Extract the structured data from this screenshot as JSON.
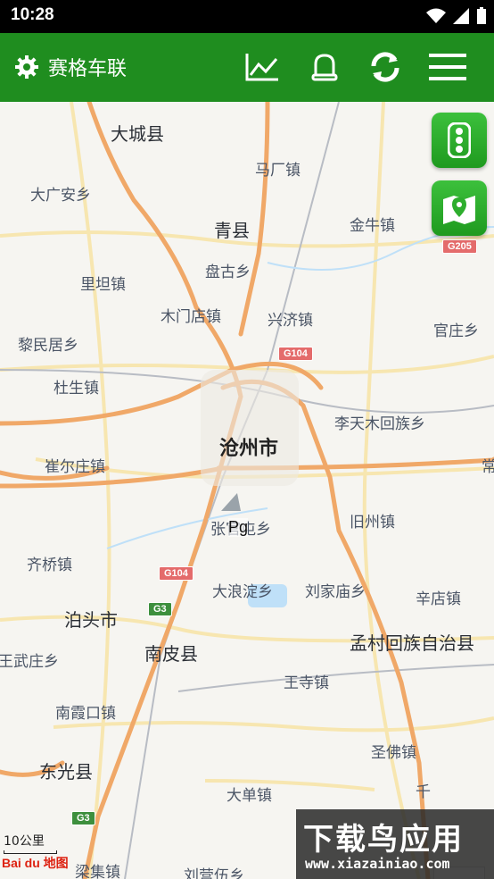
{
  "status_bar": {
    "time": "10:28"
  },
  "app_bar": {
    "title": "赛格车联",
    "icons": [
      "gear-icon",
      "chart-icon",
      "bell-icon",
      "refresh-icon",
      "menu-icon"
    ]
  },
  "colors": {
    "app_bar": "#1f8d1f",
    "fab": "#2eae2e",
    "route": "#f0a868",
    "water": "#bfe0f8"
  },
  "map": {
    "labels": {
      "dacheng": "大城县",
      "mafang": "马厂镇",
      "daguangan": "大广安乡",
      "qingxian": "青县",
      "jinniu": "金牛镇",
      "pangu": "盘古乡",
      "litan": "里坦镇",
      "mumendian": "木门店镇",
      "xingji": "兴济镇",
      "guanzhuang": "官庄乡",
      "lixiu": "黎民居乡",
      "duzhen": "杜生镇",
      "litianmu": "李天木回族乡",
      "cangzhou": "沧州市",
      "cuierzhuang": "崔尔庄镇",
      "chang": "常",
      "zhangguantun": "张官屯乡",
      "jiuzhou": "旧州镇",
      "qiqiao": "齐桥镇",
      "dalangdian": "大浪淀乡",
      "liujiamiao": "刘家庙乡",
      "xindian": "辛店镇",
      "botou": "泊头市",
      "nanpi": "南皮县",
      "mengcun": "孟村回族自治县",
      "wangwuzhuang": "王武庄乡",
      "wangsi": "王寺镇",
      "nanxiakou": "南霞口镇",
      "shengfo": "圣佛镇",
      "dongguang": "东光县",
      "dadan": "大单镇",
      "qian": "千",
      "liangji": "梁集镇",
      "liuying": "刘营伍乡"
    },
    "shields": {
      "g104_top": "G104",
      "g205": "G205",
      "g104_bottom": "G104",
      "g3_mid": "G3",
      "g3_bottom": "G3"
    },
    "marker_label": "Pg",
    "scale": "10公里",
    "provider_logo": "Bai du 地图"
  },
  "controls": {
    "zoom_in": "+"
  },
  "watermark": {
    "title": "下载鸟应用",
    "url": "www.xiazainiao.com"
  }
}
